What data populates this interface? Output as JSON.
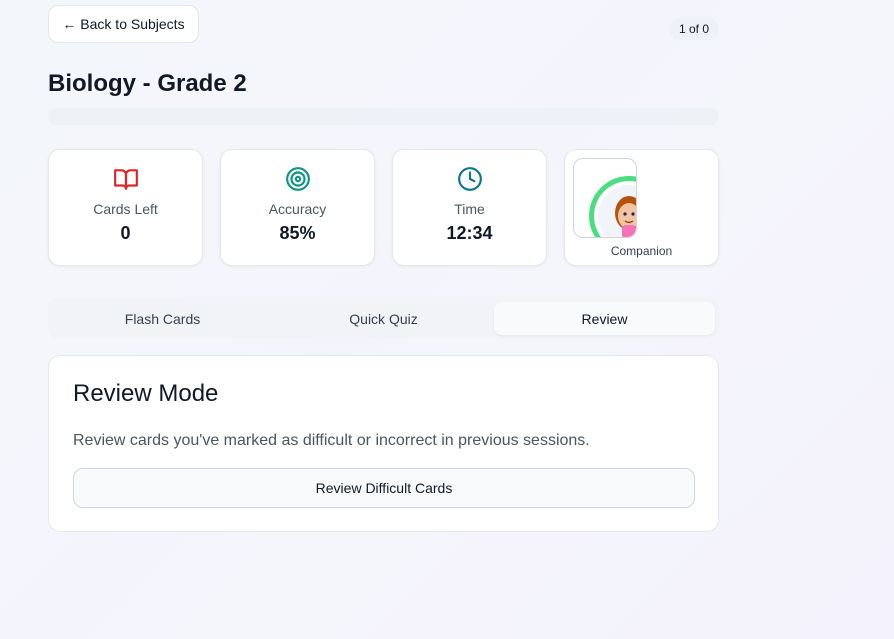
{
  "header": {
    "back_label": "← Back to Subjects",
    "page_counter": "1 of 0",
    "title": "Biology - Grade 2",
    "progress_fraction": 0
  },
  "stats": [
    {
      "icon": "book-icon",
      "label": "Cards Left",
      "value": "0",
      "color": "#dc2626"
    },
    {
      "icon": "target-icon",
      "label": "Accuracy",
      "value": "85%",
      "color": "#0d9488"
    },
    {
      "icon": "clock-icon",
      "label": "Time",
      "value": "12:34",
      "color": "#0e7490"
    },
    {
      "icon": "companion-avatar",
      "label": "Companion",
      "ring_color": "#4ade80"
    }
  ],
  "tabs": [
    {
      "label": "Flash Cards",
      "active": false
    },
    {
      "label": "Quick Quiz",
      "active": false
    },
    {
      "label": "Review",
      "active": true
    }
  ],
  "review": {
    "title": "Review Mode",
    "description": "Review cards you've marked as difficult or incorrect in previous sessions.",
    "button_label": "Review Difficult Cards"
  }
}
